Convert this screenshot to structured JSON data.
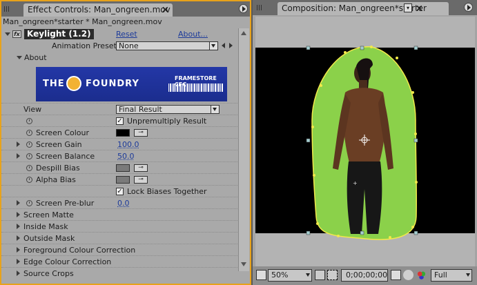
{
  "effect_panel": {
    "tab_label": "Effect Controls: Man_ongreen.mov",
    "breadcrumb": "Man_ongreen*starter * Man_ongreen.mov",
    "effect_name": "Keylight (1.2)",
    "reset_label": "Reset",
    "about_link": "About...",
    "animation_presets_label": "Animation Presets:",
    "animation_presets_value": "None",
    "about_section": "About",
    "banner": {
      "brand": "THE",
      "brand2": "FOUNDRY",
      "partner": "FRAMESTORE CFC"
    },
    "params": [
      {
        "label": "View",
        "value": "Final Result",
        "kind": "select"
      },
      {
        "label": "",
        "value": "Unpremultiply Result",
        "kind": "checkbox",
        "checked": true
      },
      {
        "label": "Screen Colour",
        "kind": "color",
        "color": "#000000"
      },
      {
        "label": "Screen Gain",
        "value": "100.0",
        "kind": "number"
      },
      {
        "label": "Screen Balance",
        "value": "50.0",
        "kind": "number"
      },
      {
        "label": "Despill Bias",
        "kind": "color",
        "color": "#7a7a7a"
      },
      {
        "label": "Alpha Bias",
        "kind": "color",
        "color": "#7a7a7a"
      },
      {
        "label": "",
        "value": "Lock Biases Together",
        "kind": "checkbox",
        "checked": true
      },
      {
        "label": "Screen Pre-blur",
        "value": "0.0",
        "kind": "number"
      }
    ],
    "groups": [
      "Screen Matte",
      "Inside Mask",
      "Outside Mask",
      "Foreground Colour Correction",
      "Edge Colour Correction",
      "Source Crops"
    ]
  },
  "comp_panel": {
    "tab_label": "Composition: Man_ongreen*starter",
    "zoom": "50%",
    "timecode": "0;00;00;00",
    "resolution": "Full"
  },
  "colors": {
    "highlight": "#e8a21a",
    "matte": "#8bd14a",
    "mask": "#f2e94a"
  }
}
